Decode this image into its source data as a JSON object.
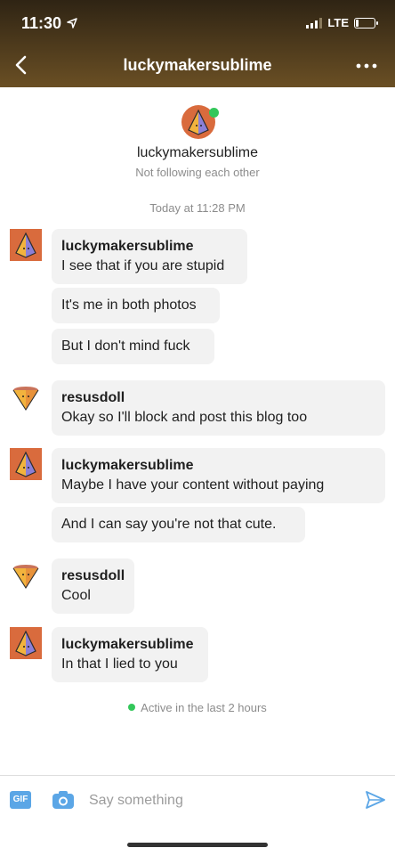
{
  "status_bar": {
    "time": "11:30",
    "network": "LTE",
    "battery_level": 0.1
  },
  "header": {
    "title": "luckymakersublime"
  },
  "profile": {
    "name": "luckymakersublime",
    "subtitle": "Not following each other"
  },
  "conversation": {
    "timestamp": "Today at 11:28 PM",
    "groups": [
      {
        "sender": "luckymakersublime",
        "messages": [
          "I see that if you are stupid",
          "It's me in both photos",
          "But I don't mind fuck"
        ]
      },
      {
        "sender": "resusdoll",
        "messages": [
          "Okay so I'll block and post this blog too"
        ]
      },
      {
        "sender": "luckymakersublime",
        "messages": [
          "Maybe I have your content without paying",
          "And I can say you're not that cute."
        ]
      },
      {
        "sender": "resusdoll",
        "messages": [
          "Cool"
        ]
      },
      {
        "sender": "luckymakersublime",
        "messages": [
          "In that I lied to you"
        ]
      }
    ],
    "active_status": "Active in the last 2 hours"
  },
  "composer": {
    "gif_label": "GIF",
    "placeholder": "Say something"
  },
  "colors": {
    "header_top": "#2f2414",
    "header_bottom": "#6a4f24",
    "online": "#33c75a",
    "accent_blue": "#5ba6e6",
    "avatar_orange": "#d96b3d"
  },
  "icons": [
    "back-chevron-icon",
    "more-dots-icon",
    "pyramid-avatar-icon",
    "cone-avatar-icon",
    "camera-icon",
    "send-arrow-icon"
  ]
}
